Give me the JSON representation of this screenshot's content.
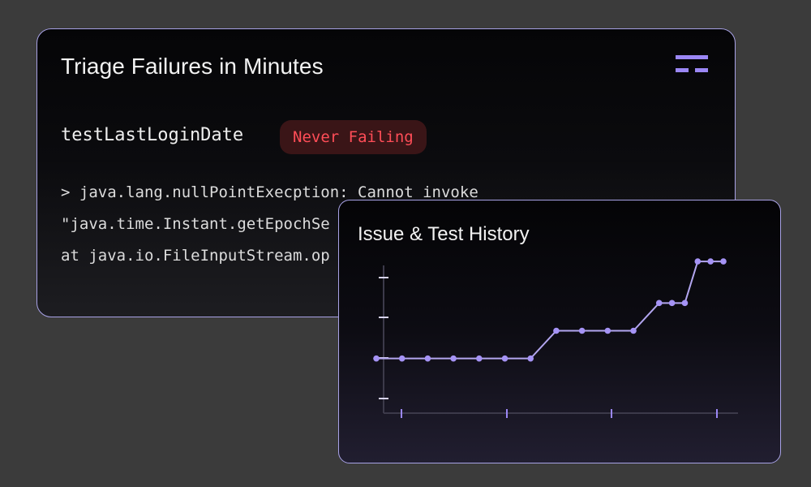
{
  "main_card": {
    "title": "Triage Failures in Minutes",
    "logo_icon": "stacked-bars-logo-icon",
    "test_name": "testLastLoginDate",
    "status_badge": "Never Failing",
    "stack_trace": [
      "> java.lang.nullPointExecption: Cannot invoke",
      "\"java.time.Instant.getEpochSe",
      "at java.io.FileInputStream.op"
    ]
  },
  "history_card": {
    "title": "Issue & Test History"
  },
  "colors": {
    "accent": "#9b87f5",
    "badge_text": "#ff4d57",
    "badge_bg": "#3a1517",
    "border": "#a8a2e6"
  },
  "chart_data": {
    "type": "line",
    "title": "",
    "xlabel": "",
    "ylabel": "",
    "ylim": [
      0,
      3
    ],
    "xlim": [
      0,
      13.5
    ],
    "series": [
      {
        "x": [
          0,
          1,
          2,
          3,
          4,
          5,
          6,
          7,
          8,
          9,
          10,
          11,
          11.5,
          12,
          12.5,
          13,
          13.5
        ],
        "values": [
          1,
          1,
          1,
          1,
          1,
          1,
          1,
          1.5,
          1.5,
          1.5,
          1.5,
          2,
          2,
          2,
          2.75,
          2.75,
          2.75
        ]
      }
    ]
  }
}
